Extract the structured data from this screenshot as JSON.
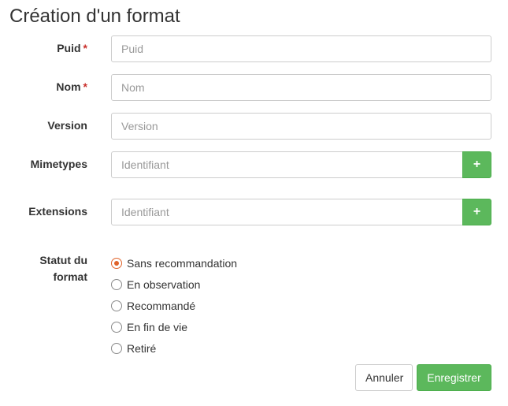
{
  "page": {
    "title": "Création d'un format"
  },
  "form": {
    "puid": {
      "label": "Puid",
      "required_mark": "*",
      "placeholder": "Puid",
      "value": ""
    },
    "nom": {
      "label": "Nom",
      "required_mark": "*",
      "placeholder": "Nom",
      "value": ""
    },
    "version": {
      "label": "Version",
      "placeholder": "Version",
      "value": ""
    },
    "mimetypes": {
      "label": "Mimetypes",
      "placeholder": "Identifiant",
      "value": "",
      "add_icon": "plus-icon",
      "add_glyph": "+"
    },
    "extensions": {
      "label": "Extensions",
      "placeholder": "Identifiant",
      "value": "",
      "add_icon": "plus-icon",
      "add_glyph": "+"
    },
    "statut": {
      "label_line1": "Statut du",
      "label_line2": "format",
      "options": [
        {
          "label": "Sans recommandation",
          "checked": true
        },
        {
          "label": "En observation",
          "checked": false
        },
        {
          "label": "Recommandé",
          "checked": false
        },
        {
          "label": "En fin de vie",
          "checked": false
        },
        {
          "label": "Retiré",
          "checked": false
        }
      ]
    }
  },
  "actions": {
    "cancel_label": "Annuler",
    "save_label": "Enregistrer"
  },
  "colors": {
    "accent_green": "#5cb85c",
    "required_red": "#c9302c",
    "radio_checked": "#e0632a"
  }
}
